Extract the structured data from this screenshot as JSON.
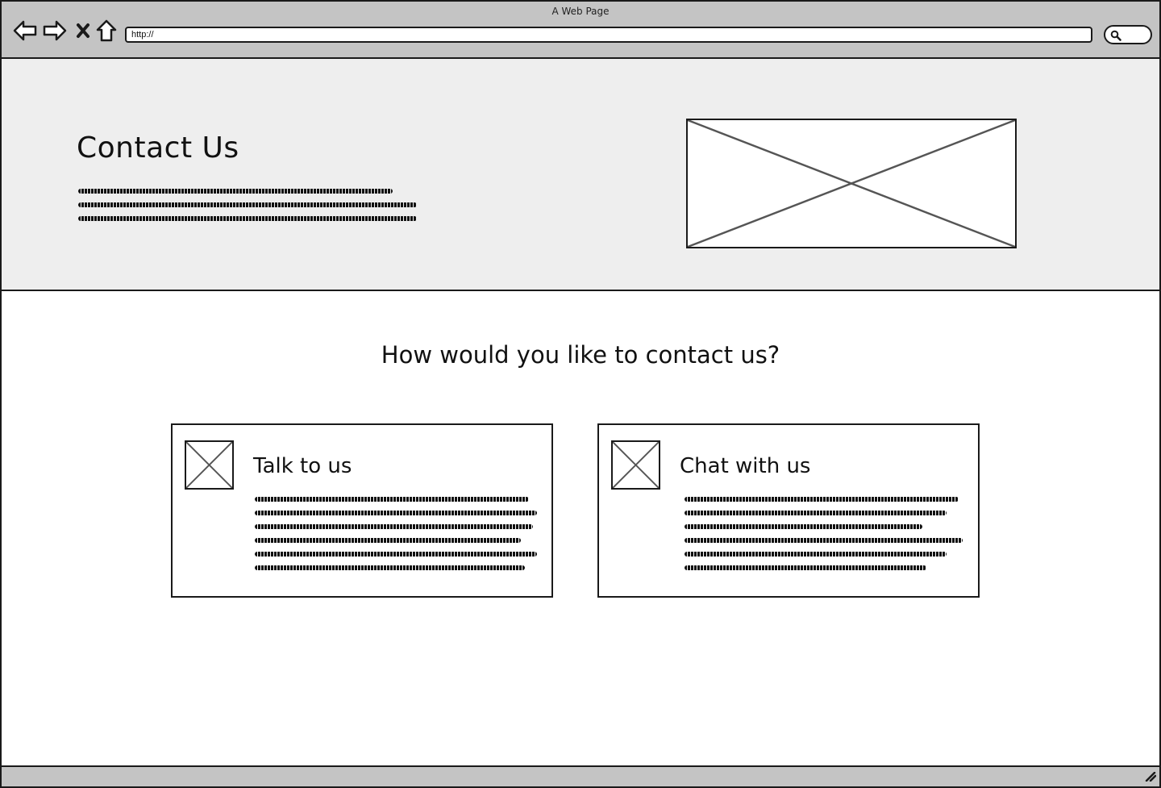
{
  "browser": {
    "window_title": "A Web Page",
    "url": "http://",
    "icons": {
      "back": "back-arrow-icon",
      "forward": "forward-arrow-icon",
      "stop": "close-icon",
      "home": "home-icon",
      "search": "search-icon",
      "resize": "resize-grip-icon"
    }
  },
  "hero": {
    "title": "Contact Us"
  },
  "section": {
    "heading": "How would you like to contact us?"
  },
  "cards": [
    {
      "title": "Talk to us"
    },
    {
      "title": "Chat with us"
    }
  ],
  "colors": {
    "chrome": "#c4c4c4",
    "hero_bg": "#eeeeee",
    "stroke": "#1a1a1a"
  }
}
